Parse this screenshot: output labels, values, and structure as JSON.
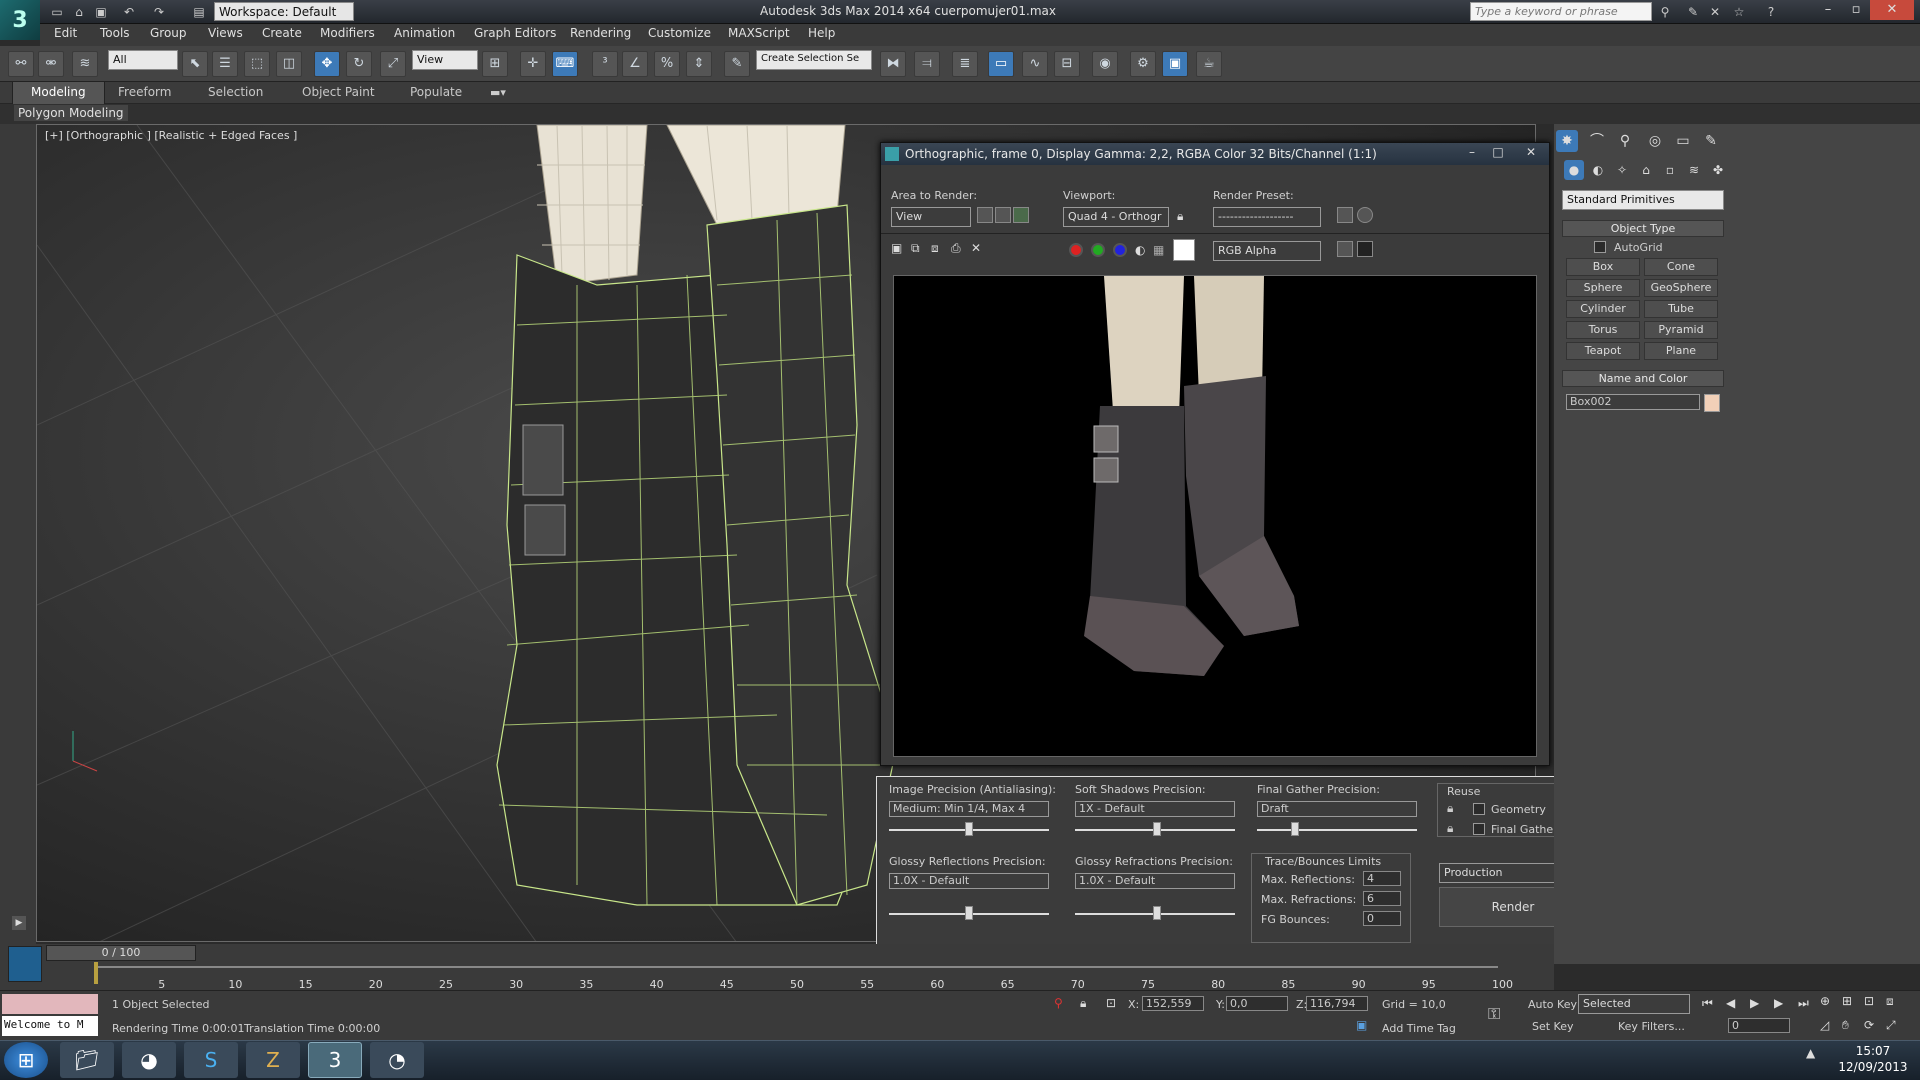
{
  "titlebar": {
    "workspace": "Workspace: Default",
    "app_title": "Autodesk 3ds Max  2014 x64     cuerpomujer01.max",
    "search_placeholder": "Type a keyword or phrase"
  },
  "menu": [
    "Edit",
    "Tools",
    "Group",
    "Views",
    "Create",
    "Modifiers",
    "Animation",
    "Graph Editors",
    "Rendering",
    "Customize",
    "MAXScript",
    "Help"
  ],
  "toolbar": {
    "selection_filter": "All",
    "ref_coord": "View",
    "named_selection": "Create Selection Se"
  },
  "ribbon": {
    "tabs": [
      "Modeling",
      "Freeform",
      "Selection",
      "Object Paint",
      "Populate"
    ],
    "sub_label": "Polygon Modeling"
  },
  "viewport": {
    "label": "[+] [Orthographic ] [Realistic + Edged Faces ]"
  },
  "frame_buffer": {
    "title": "Orthographic, frame 0, Display Gamma: 2,2, RGBA Color 32 Bits/Channel (1:1)",
    "area_to_render_label": "Area to Render:",
    "area_to_render": "View",
    "viewport_label": "Viewport:",
    "viewport_value": "Quad 4 - Orthogr",
    "render_preset_label": "Render Preset:",
    "render_preset": "-------------------",
    "channel": "RGB Alpha"
  },
  "render_setup": {
    "image_precision_label": "Image Precision (Antialiasing):",
    "image_precision": "Medium: Min 1/4, Max 4",
    "soft_shadows_label": "Soft Shadows Precision:",
    "soft_shadows": "1X - Default",
    "final_gather_label": "Final Gather Precision:",
    "final_gather": "Draft",
    "glossy_refl_label": "Glossy Reflections Precision:",
    "glossy_refl": "1.0X - Default",
    "glossy_refr_label": "Glossy Refractions Precision:",
    "glossy_refr": "1.0X - Default",
    "reuse_label": "Reuse",
    "geometry_label": "Geometry",
    "final_gather_reuse_label": "Final Gather",
    "trace_label": "Trace/Bounces Limits",
    "max_reflections_label": "Max. Reflections:",
    "max_reflections": "4",
    "max_refractions_label": "Max. Refractions:",
    "max_refractions": "6",
    "fg_bounces_label": "FG Bounces:",
    "fg_bounces": "0",
    "mode": "Production",
    "render_button": "Render"
  },
  "command_panel": {
    "category": "Standard Primitives",
    "object_type_label": "Object Type",
    "autogrid_label": "AutoGrid",
    "primitives": [
      "Box",
      "Cone",
      "Sphere",
      "GeoSphere",
      "Cylinder",
      "Tube",
      "Torus",
      "Pyramid",
      "Teapot",
      "Plane"
    ],
    "name_color_label": "Name and Color",
    "object_name": "Box002",
    "object_color": "#f2d0b8"
  },
  "timeline": {
    "slider": "0 / 100",
    "ticks": [
      "5",
      "10",
      "15",
      "20",
      "25",
      "30",
      "35",
      "40",
      "45",
      "50",
      "55",
      "60",
      "65",
      "70",
      "75",
      "80",
      "85",
      "90",
      "95",
      "100"
    ]
  },
  "status": {
    "maxscript": "Welcome to M",
    "selected": "1 Object Selected",
    "rendering_time": "Rendering Time  0:00:01",
    "translation_time": "Translation Time  0:00:00",
    "x_label": "X:",
    "x": "152,559",
    "y_label": "Y:",
    "y": "0,0",
    "z_label": "Z:",
    "z": "116,794",
    "grid": "Grid = 10,0",
    "auto_key": "Auto Key",
    "key_mode": "Selected",
    "set_key": "Set Key",
    "key_filters": "Key Filters...",
    "add_time_tag": "Add Time Tag",
    "frame": "0"
  },
  "taskbar": {
    "time": "15:07",
    "date": "12/09/2013"
  }
}
